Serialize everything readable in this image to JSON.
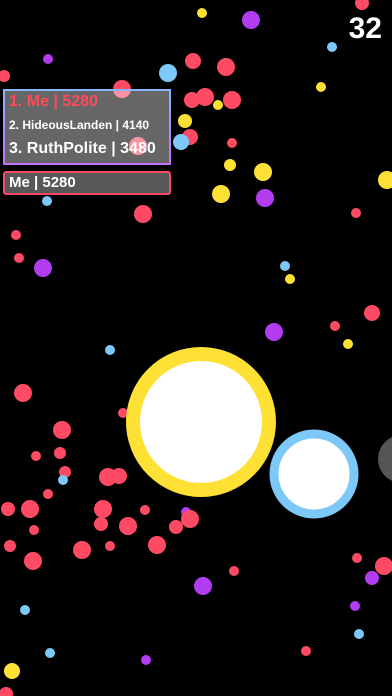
{
  "hud": {
    "timer": "32"
  },
  "leaderboard": {
    "rows": [
      {
        "text": "1. Me | 5280"
      },
      {
        "text": "2. HideousLanden | 4140"
      },
      {
        "text": "3. RuthPolite | 3480"
      }
    ]
  },
  "me_box": {
    "text": "Me | 5280"
  },
  "colors": {
    "background": "#000000",
    "pink": "#ff4a64",
    "purple": "#b23cf0",
    "yellow": "#ffe135",
    "light_blue": "#7cc8f8",
    "player_fill": "#ffffff",
    "player_ring": "#ffe135",
    "rival_ring": "#7cc8f8",
    "grey_blob": "#555555"
  }
}
